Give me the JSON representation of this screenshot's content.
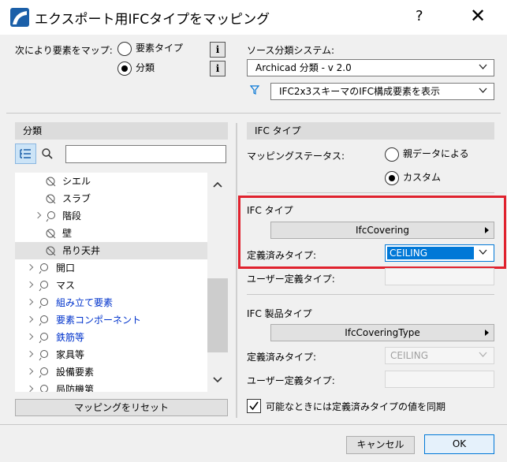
{
  "window": {
    "title": "エクスポート用IFCタイプをマッピング",
    "help": "?",
    "close": "✕"
  },
  "map_by": {
    "label": "次により要素をマップ:",
    "options": [
      {
        "label": "要素タイプ",
        "selected": false
      },
      {
        "label": "分類",
        "selected": true
      }
    ],
    "info_glyph": "i"
  },
  "source": {
    "label": "ソース分類システム:",
    "value": "Archicad 分類 - v 2.0",
    "filter_value": "IFC2x3スキーマのIFC構成要素を表示"
  },
  "classification_panel": {
    "header": "分類",
    "search_placeholder": "",
    "tree": [
      {
        "label": "シエル",
        "blue": false,
        "selected": false
      },
      {
        "label": "スラブ",
        "blue": false,
        "selected": false
      },
      {
        "label": "階段",
        "blue": false,
        "selected": false
      },
      {
        "label": "壁",
        "blue": false,
        "selected": false
      },
      {
        "label": "吊り天井",
        "blue": false,
        "selected": true
      },
      {
        "label": "開口",
        "blue": false,
        "selected": false
      },
      {
        "label": "マス",
        "blue": false,
        "selected": false
      },
      {
        "label": "組み立て要素",
        "blue": true,
        "selected": false
      },
      {
        "label": "要素コンポーネント",
        "blue": true,
        "selected": false
      },
      {
        "label": "鉄筋等",
        "blue": true,
        "selected": false
      },
      {
        "label": "家具等",
        "blue": false,
        "selected": false
      },
      {
        "label": "設備要素",
        "blue": false,
        "selected": false
      },
      {
        "label": "局防機第",
        "blue": false,
        "selected": false
      }
    ],
    "reset_button": "マッピングをリセット"
  },
  "ifc_type_panel": {
    "header": "IFC タイプ",
    "mapping_status_label": "マッピングステータス:",
    "status_options": [
      {
        "label": "親データによる",
        "selected": false
      },
      {
        "label": "カスタム",
        "selected": true
      }
    ],
    "ifc_type_label": "IFC タイプ",
    "ifc_type_value": "IfcCovering",
    "predefined_label": "定義済みタイプ:",
    "predefined_value": "CEILING",
    "user_defined_label": "ユーザー定義タイプ:",
    "user_defined_value": ""
  },
  "product_type_panel": {
    "header": "IFC 製品タイプ",
    "value": "IfcCoveringType",
    "predefined_label": "定義済みタイプ:",
    "predefined_value": "CEILING",
    "user_defined_label": "ユーザー定義タイプ:",
    "user_defined_value": ""
  },
  "sync": {
    "label": "可能なときには定義済みタイプの値を同期",
    "checked": true
  },
  "footer": {
    "cancel": "キャンセル",
    "ok": "OK"
  },
  "colors": {
    "highlight_box": "#e0222e",
    "selection_blue": "#0078d7",
    "blue_text": "#0033cc"
  }
}
